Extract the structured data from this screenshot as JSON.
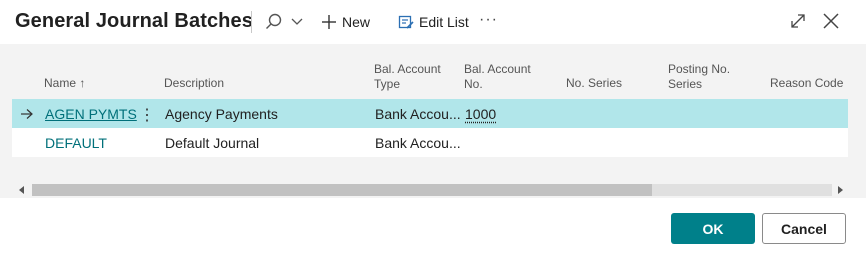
{
  "dialog": {
    "title": "General Journal Batches",
    "toolbar": {
      "new_label": "New",
      "edit_list_label": "Edit List",
      "more_label": "···"
    }
  },
  "grid": {
    "columns": [
      {
        "key": "name",
        "label": "Name",
        "sort_indicator": "↑"
      },
      {
        "key": "description",
        "label": "Description"
      },
      {
        "key": "bal_account_type",
        "label": "Bal. Account Type"
      },
      {
        "key": "bal_account_no",
        "label": "Bal. Account No."
      },
      {
        "key": "no_series",
        "label": "No. Series"
      },
      {
        "key": "posting_no_series",
        "label": "Posting No. Series"
      },
      {
        "key": "reason_code",
        "label": "Reason Code"
      }
    ],
    "header_lines": {
      "bal_account_type": [
        "Bal. Account",
        "Type"
      ],
      "bal_account_no": [
        "Bal. Account",
        "No."
      ],
      "posting_no_series": [
        "Posting No.",
        "Series"
      ]
    },
    "rows": [
      {
        "name": "AGEN PYMTS",
        "description": "Agency Payments",
        "bal_account_type": "Bank Accou...",
        "bal_account_no": "1000",
        "no_series": "",
        "posting_no_series": "",
        "reason_code": "",
        "selected": true
      },
      {
        "name": "DEFAULT",
        "description": "Default Journal",
        "bal_account_type": "Bank Accou...",
        "bal_account_no": "",
        "no_series": "",
        "posting_no_series": "",
        "reason_code": "",
        "selected": false
      }
    ]
  },
  "footer": {
    "ok_label": "OK",
    "cancel_label": "Cancel"
  },
  "colors": {
    "accent": "#00808a",
    "link": "#00707a",
    "selected_row": "#b1e6ea",
    "grid_background": "#f3f3f3"
  },
  "icons": [
    "search-icon",
    "chevron-down-icon",
    "plus-icon",
    "edit-list-icon",
    "more-icon",
    "expand-icon",
    "close-icon",
    "row-arrow-icon",
    "kebab-icon",
    "scroll-left-icon",
    "scroll-right-icon"
  ]
}
